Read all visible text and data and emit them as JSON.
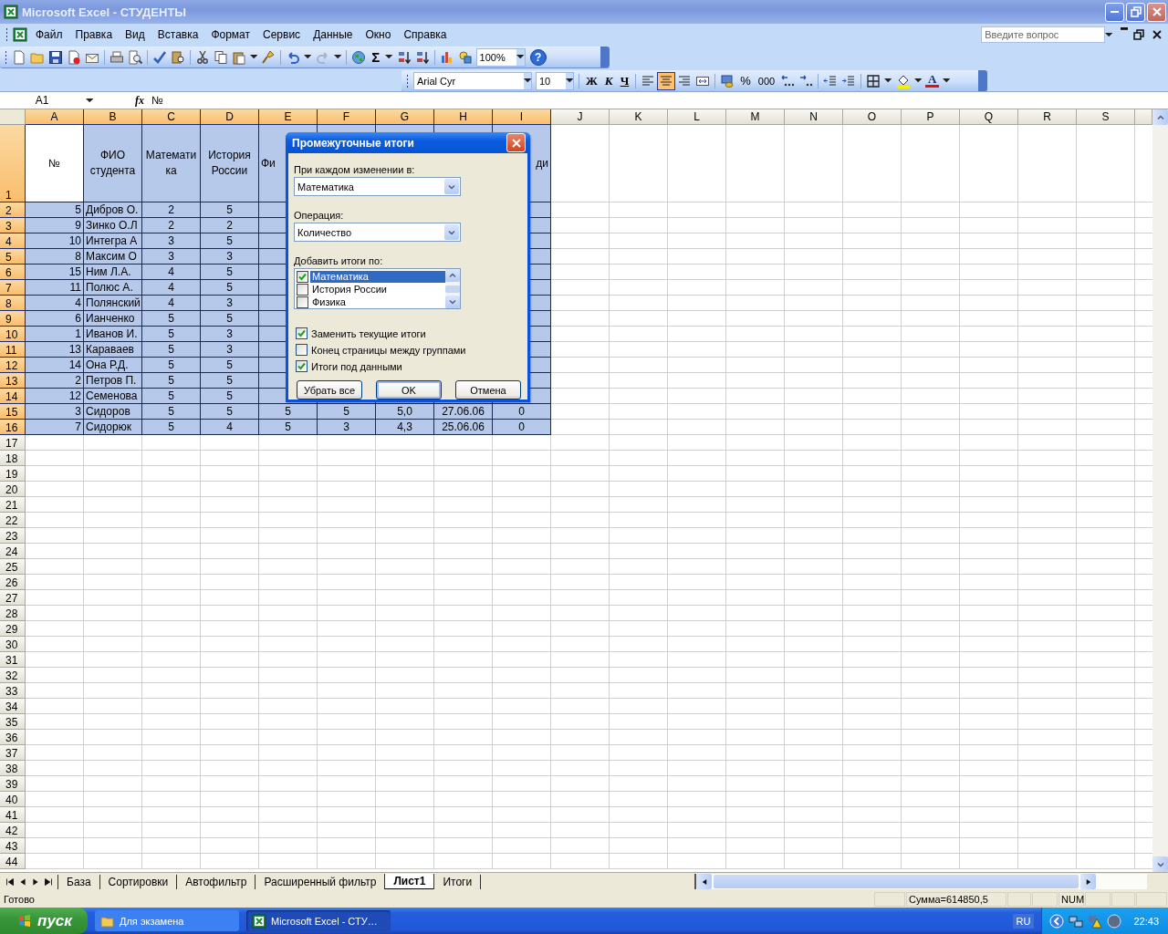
{
  "window": {
    "title": "Microsoft Excel - СТУДЕНТЫ"
  },
  "menu": [
    "Файл",
    "Правка",
    "Вид",
    "Вставка",
    "Формат",
    "Сервис",
    "Данные",
    "Окно",
    "Справка"
  ],
  "help_box": {
    "placeholder": "Введите вопрос"
  },
  "standard_toolbar": {
    "sum_symbol": "Σ",
    "zoom": "100%",
    "help_symbol": "?"
  },
  "formatting_toolbar": {
    "font": "Arial Cyr",
    "font_size": "10",
    "bold": "Ж",
    "italic": "К",
    "underline": "Ч",
    "alignment": [
      {
        "selected": false
      },
      {
        "selected": true
      },
      {
        "selected": false
      }
    ],
    "percent": "%",
    "thousands": "000",
    "font_color_letter": "A"
  },
  "formula_bar": {
    "name_box": "A1",
    "function_label": "fx",
    "value": "№"
  },
  "sheet": {
    "columns": [
      {
        "label": "A",
        "selected": true
      },
      {
        "label": "B",
        "selected": true
      },
      {
        "label": "C",
        "selected": true
      },
      {
        "label": "D",
        "selected": true
      },
      {
        "label": "E",
        "selected": true
      },
      {
        "label": "F",
        "selected": true
      },
      {
        "label": "G",
        "selected": true
      },
      {
        "label": "H",
        "selected": true
      },
      {
        "label": "I",
        "selected": true
      },
      {
        "label": "J",
        "selected": false
      },
      {
        "label": "K",
        "selected": false
      },
      {
        "label": "L",
        "selected": false
      },
      {
        "label": "M",
        "selected": false
      },
      {
        "label": "N",
        "selected": false
      },
      {
        "label": "O",
        "selected": false
      },
      {
        "label": "P",
        "selected": false
      },
      {
        "label": "Q",
        "selected": false
      },
      {
        "label": "R",
        "selected": false
      },
      {
        "label": "S",
        "selected": false
      }
    ],
    "rows": [
      {
        "header": "1",
        "selected": true,
        "cells": [
          {
            "text": "№",
            "active": true
          },
          "ФИО студента",
          "Математика",
          "История России",
          "Фи",
          null,
          null,
          null,
          "ди"
        ]
      },
      {
        "header": "2",
        "selected": true,
        "cells": [
          "5",
          "Дибров О.",
          "2",
          "5"
        ]
      },
      {
        "header": "3",
        "selected": true,
        "cells": [
          "9",
          "Зинко О.Л",
          "2",
          "2"
        ]
      },
      {
        "header": "4",
        "selected": true,
        "cells": [
          "10",
          "Интегра А",
          "3",
          "5"
        ]
      },
      {
        "header": "5",
        "selected": true,
        "cells": [
          "8",
          "Максим О",
          "3",
          "3"
        ]
      },
      {
        "header": "6",
        "selected": true,
        "cells": [
          "15",
          "Ним Л.А.",
          "4",
          "5"
        ]
      },
      {
        "header": "7",
        "selected": true,
        "cells": [
          "11",
          "Полюс А.",
          "4",
          "5"
        ]
      },
      {
        "header": "8",
        "selected": true,
        "cells": [
          "4",
          "Полянский",
          "4",
          "3"
        ]
      },
      {
        "header": "9",
        "selected": true,
        "cells": [
          "6",
          "Ианченко",
          "5",
          "5"
        ]
      },
      {
        "header": "10",
        "selected": true,
        "cells": [
          "1",
          "Иванов И.",
          "5",
          "3"
        ]
      },
      {
        "header": "11",
        "selected": true,
        "cells": [
          "13",
          "Караваев",
          "5",
          "3"
        ]
      },
      {
        "header": "12",
        "selected": true,
        "cells": [
          "14",
          "Она Р.Д.",
          "5",
          "5"
        ]
      },
      {
        "header": "13",
        "selected": true,
        "cells": [
          "2",
          "Петров П.",
          "5",
          "5"
        ]
      },
      {
        "header": "14",
        "selected": true,
        "cells": [
          "12",
          "Семенова",
          "5",
          "5"
        ]
      },
      {
        "header": "15",
        "selected": true,
        "cells": [
          "3",
          "Сидоров",
          "5",
          "5",
          "5",
          "5",
          "5,0",
          "27.06.06",
          "0"
        ]
      },
      {
        "header": "16",
        "selected": true,
        "cells": [
          "7",
          "Сидорюк",
          "5",
          "4",
          "5",
          "3",
          "4,3",
          "25.06.06",
          "0"
        ]
      },
      {
        "header": "17",
        "selected": false
      },
      {
        "header": "18",
        "selected": false
      },
      {
        "header": "19",
        "selected": false
      },
      {
        "header": "20",
        "selected": false
      },
      {
        "header": "21",
        "selected": false
      },
      {
        "header": "22",
        "selected": false
      },
      {
        "header": "23",
        "selected": false
      },
      {
        "header": "24",
        "selected": false
      },
      {
        "header": "25",
        "selected": false
      },
      {
        "header": "26",
        "selected": false
      },
      {
        "header": "27",
        "selected": false
      },
      {
        "header": "28",
        "selected": false
      },
      {
        "header": "29",
        "selected": false
      },
      {
        "header": "30",
        "selected": false
      },
      {
        "header": "31",
        "selected": false
      },
      {
        "header": "32",
        "selected": false
      },
      {
        "header": "33",
        "selected": false
      },
      {
        "header": "34",
        "selected": false
      },
      {
        "header": "35",
        "selected": false
      },
      {
        "header": "36",
        "selected": false
      },
      {
        "header": "37",
        "selected": false
      },
      {
        "header": "38",
        "selected": false
      },
      {
        "header": "39",
        "selected": false
      },
      {
        "header": "40",
        "selected": false
      },
      {
        "header": "41",
        "selected": false
      },
      {
        "header": "42",
        "selected": false
      },
      {
        "header": "43",
        "selected": false
      },
      {
        "header": "44",
        "selected": false
      }
    ]
  },
  "dialog": {
    "title": "Промежуточные итоги",
    "group_by": {
      "label": "При каждом изменении в:",
      "value": "Математика"
    },
    "function": {
      "label": "Операция:",
      "value": "Количество"
    },
    "subtotal_list": {
      "label": "Добавить итоги по:",
      "items": [
        {
          "label": "Математика",
          "checked": true,
          "selected": true
        },
        {
          "label": "История России",
          "checked": false,
          "selected": false
        },
        {
          "label": "Физика",
          "checked": false,
          "selected": false
        }
      ]
    },
    "options": [
      {
        "label": "Заменить текущие итоги",
        "checked": true
      },
      {
        "label": "Конец страницы между группами",
        "checked": false
      },
      {
        "label": "Итоги под данными",
        "checked": true
      }
    ],
    "buttons": [
      {
        "label": "Убрать все",
        "default": false
      },
      {
        "label": "OK",
        "default": true
      },
      {
        "label": "Отмена",
        "default": false
      }
    ]
  },
  "sheet_tabs": [
    {
      "label": "База",
      "selected": false
    },
    {
      "label": "Сортировки",
      "selected": false
    },
    {
      "label": "Автофильтр",
      "selected": false
    },
    {
      "label": "Расширенный фильтр",
      "selected": false
    },
    {
      "label": "Лист1",
      "selected": true
    },
    {
      "label": "Итоги",
      "selected": false
    }
  ],
  "status_bar": {
    "status": "Готово",
    "sum": "Сумма=614850,5",
    "num_lock": "NUM"
  },
  "taskbar": {
    "start": "пуск",
    "tasks": [
      {
        "label": "Для экзамена",
        "kind": "folder",
        "selected": false
      },
      {
        "label": "Microsoft Excel - СТУ…",
        "kind": "spreadsheet",
        "selected": true
      }
    ],
    "language": "RU",
    "clock": "22:43"
  }
}
